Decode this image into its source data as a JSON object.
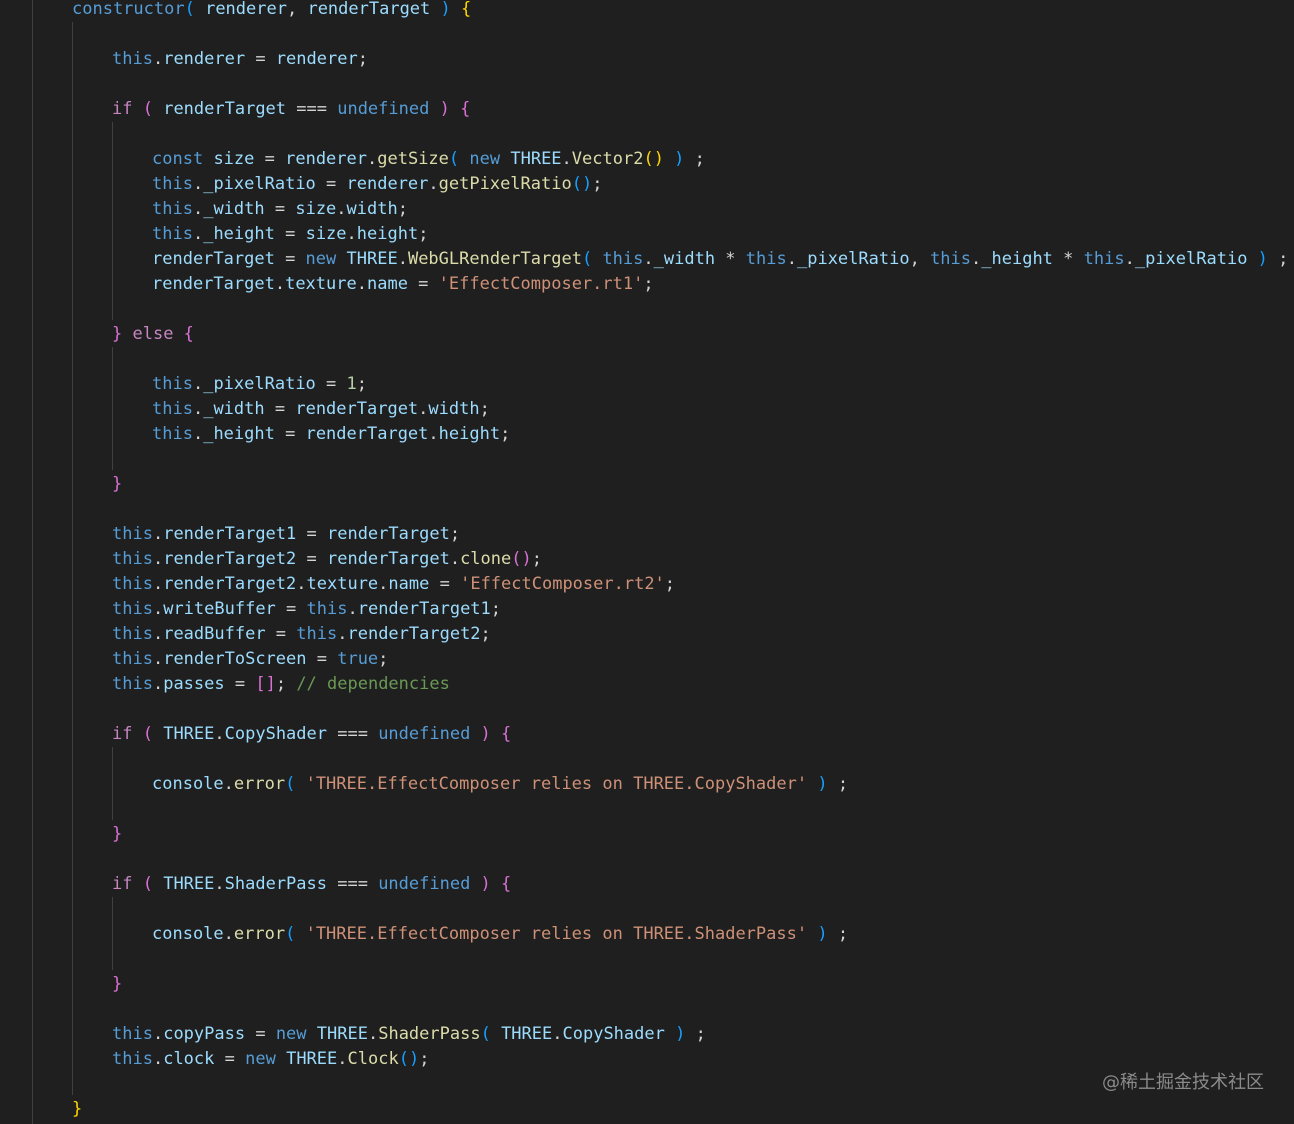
{
  "editor": {
    "colors": {
      "background": "#1f1f1f",
      "keyword": "#569cd6",
      "control": "#c586c0",
      "identifier": "#9cdcfe",
      "function": "#dcdcaa",
      "type": "#4ec9b0",
      "string": "#ce9178",
      "number": "#b5cea8",
      "comment": "#6a9955",
      "bracket1": "#ffd700",
      "bracket2": "#da70d6",
      "bracket3": "#179fff",
      "default": "#d4d4d4"
    },
    "lines": [
      {
        "indent": 0,
        "tokens": [
          [
            "constructor",
            "kw"
          ],
          [
            "( ",
            "b3"
          ],
          [
            "renderer",
            "id"
          ],
          [
            ", ",
            "def"
          ],
          [
            "renderTarget",
            "id"
          ],
          [
            " ) ",
            "b3"
          ],
          [
            "{",
            "b1"
          ]
        ]
      },
      {
        "indent": 1,
        "tokens": []
      },
      {
        "indent": 1,
        "tokens": [
          [
            "this",
            "kw"
          ],
          [
            ".",
            "def"
          ],
          [
            "renderer",
            "id"
          ],
          [
            " = ",
            "def"
          ],
          [
            "renderer",
            "id"
          ],
          [
            ";",
            "def"
          ]
        ]
      },
      {
        "indent": 1,
        "tokens": []
      },
      {
        "indent": 1,
        "tokens": [
          [
            "if",
            "ctl"
          ],
          [
            " ( ",
            "b2"
          ],
          [
            "renderTarget",
            "id"
          ],
          [
            " === ",
            "def"
          ],
          [
            "undefined",
            "kw"
          ],
          [
            " ) ",
            "b2"
          ],
          [
            "{",
            "b2"
          ]
        ]
      },
      {
        "indent": 2,
        "tokens": []
      },
      {
        "indent": 2,
        "tokens": [
          [
            "const",
            "kw"
          ],
          [
            " ",
            "def"
          ],
          [
            "size",
            "id"
          ],
          [
            " = ",
            "def"
          ],
          [
            "renderer",
            "id"
          ],
          [
            ".",
            "def"
          ],
          [
            "getSize",
            "fn"
          ],
          [
            "( ",
            "b3"
          ],
          [
            "new",
            "kw"
          ],
          [
            " ",
            "def"
          ],
          [
            "THREE",
            "id"
          ],
          [
            ".",
            "def"
          ],
          [
            "Vector2",
            "fn"
          ],
          [
            "()",
            "b1"
          ],
          [
            " ) ",
            "b3"
          ],
          [
            ";",
            "def"
          ]
        ]
      },
      {
        "indent": 2,
        "tokens": [
          [
            "this",
            "kw"
          ],
          [
            ".",
            "def"
          ],
          [
            "_pixelRatio",
            "id"
          ],
          [
            " = ",
            "def"
          ],
          [
            "renderer",
            "id"
          ],
          [
            ".",
            "def"
          ],
          [
            "getPixelRatio",
            "fn"
          ],
          [
            "()",
            "b3"
          ],
          [
            ";",
            "def"
          ]
        ]
      },
      {
        "indent": 2,
        "tokens": [
          [
            "this",
            "kw"
          ],
          [
            ".",
            "def"
          ],
          [
            "_width",
            "id"
          ],
          [
            " = ",
            "def"
          ],
          [
            "size",
            "id"
          ],
          [
            ".",
            "def"
          ],
          [
            "width",
            "id"
          ],
          [
            ";",
            "def"
          ]
        ]
      },
      {
        "indent": 2,
        "tokens": [
          [
            "this",
            "kw"
          ],
          [
            ".",
            "def"
          ],
          [
            "_height",
            "id"
          ],
          [
            " = ",
            "def"
          ],
          [
            "size",
            "id"
          ],
          [
            ".",
            "def"
          ],
          [
            "height",
            "id"
          ],
          [
            ";",
            "def"
          ]
        ]
      },
      {
        "indent": 2,
        "tokens": [
          [
            "renderTarget",
            "id"
          ],
          [
            " = ",
            "def"
          ],
          [
            "new",
            "kw"
          ],
          [
            " ",
            "def"
          ],
          [
            "THREE",
            "id"
          ],
          [
            ".",
            "def"
          ],
          [
            "WebGLRenderTarget",
            "fn"
          ],
          [
            "( ",
            "b3"
          ],
          [
            "this",
            "kw"
          ],
          [
            ".",
            "def"
          ],
          [
            "_width",
            "id"
          ],
          [
            " * ",
            "def"
          ],
          [
            "this",
            "kw"
          ],
          [
            ".",
            "def"
          ],
          [
            "_pixelRatio",
            "id"
          ],
          [
            ", ",
            "def"
          ],
          [
            "this",
            "kw"
          ],
          [
            ".",
            "def"
          ],
          [
            "_height",
            "id"
          ],
          [
            " * ",
            "def"
          ],
          [
            "this",
            "kw"
          ],
          [
            ".",
            "def"
          ],
          [
            "_pixelRatio",
            "id"
          ],
          [
            " ) ",
            "b3"
          ],
          [
            ";",
            "def"
          ]
        ]
      },
      {
        "indent": 2,
        "tokens": [
          [
            "renderTarget",
            "id"
          ],
          [
            ".",
            "def"
          ],
          [
            "texture",
            "id"
          ],
          [
            ".",
            "def"
          ],
          [
            "name",
            "id"
          ],
          [
            " = ",
            "def"
          ],
          [
            "'EffectComposer.rt1'",
            "str"
          ],
          [
            ";",
            "def"
          ]
        ]
      },
      {
        "indent": 2,
        "tokens": []
      },
      {
        "indent": 1,
        "tokens": [
          [
            "}",
            "b2"
          ],
          [
            " else ",
            "ctl"
          ],
          [
            "{",
            "b2"
          ]
        ]
      },
      {
        "indent": 2,
        "tokens": []
      },
      {
        "indent": 2,
        "tokens": [
          [
            "this",
            "kw"
          ],
          [
            ".",
            "def"
          ],
          [
            "_pixelRatio",
            "id"
          ],
          [
            " = ",
            "def"
          ],
          [
            "1",
            "num"
          ],
          [
            ";",
            "def"
          ]
        ]
      },
      {
        "indent": 2,
        "tokens": [
          [
            "this",
            "kw"
          ],
          [
            ".",
            "def"
          ],
          [
            "_width",
            "id"
          ],
          [
            " = ",
            "def"
          ],
          [
            "renderTarget",
            "id"
          ],
          [
            ".",
            "def"
          ],
          [
            "width",
            "id"
          ],
          [
            ";",
            "def"
          ]
        ]
      },
      {
        "indent": 2,
        "tokens": [
          [
            "this",
            "kw"
          ],
          [
            ".",
            "def"
          ],
          [
            "_height",
            "id"
          ],
          [
            " = ",
            "def"
          ],
          [
            "renderTarget",
            "id"
          ],
          [
            ".",
            "def"
          ],
          [
            "height",
            "id"
          ],
          [
            ";",
            "def"
          ]
        ]
      },
      {
        "indent": 2,
        "tokens": []
      },
      {
        "indent": 1,
        "tokens": [
          [
            "}",
            "b2"
          ]
        ]
      },
      {
        "indent": 1,
        "tokens": []
      },
      {
        "indent": 1,
        "tokens": [
          [
            "this",
            "kw"
          ],
          [
            ".",
            "def"
          ],
          [
            "renderTarget1",
            "id"
          ],
          [
            " = ",
            "def"
          ],
          [
            "renderTarget",
            "id"
          ],
          [
            ";",
            "def"
          ]
        ]
      },
      {
        "indent": 1,
        "tokens": [
          [
            "this",
            "kw"
          ],
          [
            ".",
            "def"
          ],
          [
            "renderTarget2",
            "id"
          ],
          [
            " = ",
            "def"
          ],
          [
            "renderTarget",
            "id"
          ],
          [
            ".",
            "def"
          ],
          [
            "clone",
            "fn"
          ],
          [
            "()",
            "b2"
          ],
          [
            ";",
            "def"
          ]
        ]
      },
      {
        "indent": 1,
        "tokens": [
          [
            "this",
            "kw"
          ],
          [
            ".",
            "def"
          ],
          [
            "renderTarget2",
            "id"
          ],
          [
            ".",
            "def"
          ],
          [
            "texture",
            "id"
          ],
          [
            ".",
            "def"
          ],
          [
            "name",
            "id"
          ],
          [
            " = ",
            "def"
          ],
          [
            "'EffectComposer.rt2'",
            "str"
          ],
          [
            ";",
            "def"
          ]
        ]
      },
      {
        "indent": 1,
        "tokens": [
          [
            "this",
            "kw"
          ],
          [
            ".",
            "def"
          ],
          [
            "writeBuffer",
            "id"
          ],
          [
            " = ",
            "def"
          ],
          [
            "this",
            "kw"
          ],
          [
            ".",
            "def"
          ],
          [
            "renderTarget1",
            "id"
          ],
          [
            ";",
            "def"
          ]
        ]
      },
      {
        "indent": 1,
        "tokens": [
          [
            "this",
            "kw"
          ],
          [
            ".",
            "def"
          ],
          [
            "readBuffer",
            "id"
          ],
          [
            " = ",
            "def"
          ],
          [
            "this",
            "kw"
          ],
          [
            ".",
            "def"
          ],
          [
            "renderTarget2",
            "id"
          ],
          [
            ";",
            "def"
          ]
        ]
      },
      {
        "indent": 1,
        "tokens": [
          [
            "this",
            "kw"
          ],
          [
            ".",
            "def"
          ],
          [
            "renderToScreen",
            "id"
          ],
          [
            " = ",
            "def"
          ],
          [
            "true",
            "kw"
          ],
          [
            ";",
            "def"
          ]
        ]
      },
      {
        "indent": 1,
        "tokens": [
          [
            "this",
            "kw"
          ],
          [
            ".",
            "def"
          ],
          [
            "passes",
            "id"
          ],
          [
            " = ",
            "def"
          ],
          [
            "[]",
            "b2"
          ],
          [
            "; ",
            "def"
          ],
          [
            "// dependencies",
            "cmt"
          ]
        ]
      },
      {
        "indent": 1,
        "tokens": []
      },
      {
        "indent": 1,
        "tokens": [
          [
            "if",
            "ctl"
          ],
          [
            " ( ",
            "b2"
          ],
          [
            "THREE",
            "id"
          ],
          [
            ".",
            "def"
          ],
          [
            "CopyShader",
            "id"
          ],
          [
            " === ",
            "def"
          ],
          [
            "undefined",
            "kw"
          ],
          [
            " ) ",
            "b2"
          ],
          [
            "{",
            "b2"
          ]
        ]
      },
      {
        "indent": 2,
        "tokens": []
      },
      {
        "indent": 2,
        "tokens": [
          [
            "console",
            "id"
          ],
          [
            ".",
            "def"
          ],
          [
            "error",
            "fn"
          ],
          [
            "( ",
            "b3"
          ],
          [
            "'THREE.EffectComposer relies on THREE.CopyShader'",
            "str"
          ],
          [
            " ) ",
            "b3"
          ],
          [
            ";",
            "def"
          ]
        ]
      },
      {
        "indent": 2,
        "tokens": []
      },
      {
        "indent": 1,
        "tokens": [
          [
            "}",
            "b2"
          ]
        ]
      },
      {
        "indent": 1,
        "tokens": []
      },
      {
        "indent": 1,
        "tokens": [
          [
            "if",
            "ctl"
          ],
          [
            " ( ",
            "b2"
          ],
          [
            "THREE",
            "id"
          ],
          [
            ".",
            "def"
          ],
          [
            "ShaderPass",
            "id"
          ],
          [
            " === ",
            "def"
          ],
          [
            "undefined",
            "kw"
          ],
          [
            " ) ",
            "b2"
          ],
          [
            "{",
            "b2"
          ]
        ]
      },
      {
        "indent": 2,
        "tokens": []
      },
      {
        "indent": 2,
        "tokens": [
          [
            "console",
            "id"
          ],
          [
            ".",
            "def"
          ],
          [
            "error",
            "fn"
          ],
          [
            "( ",
            "b3"
          ],
          [
            "'THREE.EffectComposer relies on THREE.ShaderPass'",
            "str"
          ],
          [
            " ) ",
            "b3"
          ],
          [
            ";",
            "def"
          ]
        ]
      },
      {
        "indent": 2,
        "tokens": []
      },
      {
        "indent": 1,
        "tokens": [
          [
            "}",
            "b2"
          ]
        ]
      },
      {
        "indent": 1,
        "tokens": []
      },
      {
        "indent": 1,
        "tokens": [
          [
            "this",
            "kw"
          ],
          [
            ".",
            "def"
          ],
          [
            "copyPass",
            "id"
          ],
          [
            " = ",
            "def"
          ],
          [
            "new",
            "kw"
          ],
          [
            " ",
            "def"
          ],
          [
            "THREE",
            "id"
          ],
          [
            ".",
            "def"
          ],
          [
            "ShaderPass",
            "fn"
          ],
          [
            "( ",
            "b3"
          ],
          [
            "THREE",
            "id"
          ],
          [
            ".",
            "def"
          ],
          [
            "CopyShader",
            "id"
          ],
          [
            " ) ",
            "b3"
          ],
          [
            ";",
            "def"
          ]
        ]
      },
      {
        "indent": 1,
        "tokens": [
          [
            "this",
            "kw"
          ],
          [
            ".",
            "def"
          ],
          [
            "clock",
            "id"
          ],
          [
            " = ",
            "def"
          ],
          [
            "new",
            "kw"
          ],
          [
            " ",
            "def"
          ],
          [
            "THREE",
            "id"
          ],
          [
            ".",
            "def"
          ],
          [
            "Clock",
            "fn"
          ],
          [
            "()",
            "b3"
          ],
          [
            ";",
            "def"
          ]
        ]
      },
      {
        "indent": 1,
        "tokens": []
      },
      {
        "indent": 0,
        "tokens": [
          [
            "}",
            "b1"
          ]
        ]
      }
    ]
  },
  "watermark": {
    "text": "@稀土掘金技术社区"
  }
}
